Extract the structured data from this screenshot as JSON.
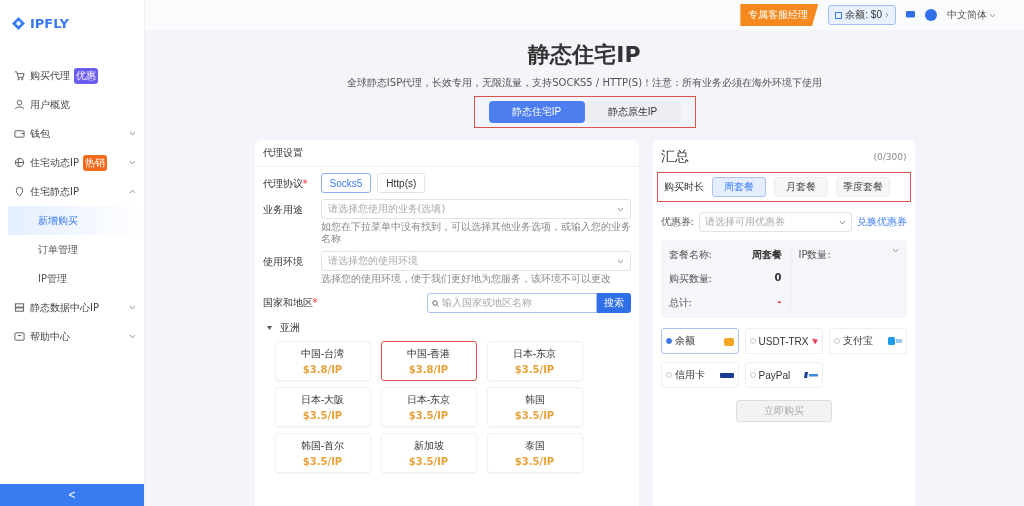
{
  "logo": {
    "text": "IPFLY"
  },
  "sidebar": {
    "items": [
      {
        "label": "购买代理",
        "badge": {
          "text": "优惠",
          "color": "#6b5cf0"
        }
      },
      {
        "label": "用户概览"
      },
      {
        "label": "钱包",
        "expanded": false
      },
      {
        "label": "住宅动态IP",
        "badge": {
          "text": "热销",
          "color": "#f26b1d"
        },
        "expanded": false
      },
      {
        "label": "住宅静态IP",
        "expanded": true,
        "children": [
          {
            "label": "新增购买",
            "selected": true
          },
          {
            "label": "订单管理",
            "selected": false
          },
          {
            "label": "IP管理",
            "selected": false
          }
        ]
      },
      {
        "label": "静态数据中心IP",
        "expanded": false
      },
      {
        "label": "帮助中心",
        "expanded": false
      }
    ],
    "collapse": "<"
  },
  "topbar": {
    "service_button": "专属客服经理",
    "balance": "余额: $0",
    "language": "中文简体"
  },
  "page": {
    "title": "静态住宅IP",
    "subtitle": "全球静态ISP代理，长效专用，无限流量，支持SOCKS5 / HTTP(S)！注意：所有业务必须在海外环境下使用",
    "tabs": [
      {
        "label": "静态住宅IP",
        "selected": true
      },
      {
        "label": "静态原生IP",
        "selected": false
      }
    ]
  },
  "proxy_settings": {
    "title": "代理设置",
    "protocol": {
      "label": "代理协议",
      "required_mark": "*",
      "options": [
        {
          "label": "Socks5",
          "selected": true
        },
        {
          "label": "Http(s)",
          "selected": false
        }
      ]
    },
    "purpose": {
      "label": "业务用途",
      "placeholder": "请选择您使用的业务(选填)",
      "hint": "如您在下拉菜单中没有找到，可以选择其他业务选项，或输入您的业务名称"
    },
    "environment": {
      "label": "使用环境",
      "placeholder": "请选择您的使用环境",
      "hint": "选择您的使用环境，便于我们更好地为您服务，该环境不可以更改"
    },
    "region": {
      "label": "国家和地区",
      "required_mark": "*",
      "search_placeholder": "输入国家或地区名称",
      "search_button": "搜索"
    },
    "group": {
      "name": "亚洲",
      "expanded": true,
      "locations": [
        {
          "name": "中国-台湾",
          "price": "$3.8/IP",
          "selected": false
        },
        {
          "name": "中国-香港",
          "price": "$3.8/IP",
          "selected": true
        },
        {
          "name": "日本-东京",
          "price": "$3.5/IP",
          "selected": false
        },
        {
          "name": "日本-大阪",
          "price": "$3.5/IP",
          "selected": false
        },
        {
          "name": "日本-东京",
          "price": "$3.5/IP",
          "selected": false
        },
        {
          "name": "韩国",
          "price": "$3.5/IP",
          "selected": false
        },
        {
          "name": "韩国-首尔",
          "price": "$3.5/IP",
          "selected": false
        },
        {
          "name": "新加坡",
          "price": "$3.5/IP",
          "selected": false
        },
        {
          "name": "泰国",
          "price": "$3.5/IP",
          "selected": false
        }
      ]
    }
  },
  "summary": {
    "title": "汇总",
    "count": "(0/300)",
    "duration": {
      "label": "购买时长",
      "options": [
        {
          "label": "周套餐",
          "selected": true
        },
        {
          "label": "月套餐",
          "selected": false
        },
        {
          "label": "季度套餐",
          "selected": false
        }
      ]
    },
    "coupon": {
      "label": "优惠券:",
      "placeholder": "请选择可用优惠券",
      "link": "兑换优惠券"
    },
    "details": [
      {
        "label": "套餐名称:",
        "value": "周套餐",
        "kind": "text"
      },
      {
        "label": "购买数量:",
        "value": "0",
        "kind": "text"
      },
      {
        "label": "总计:",
        "value": "-",
        "kind": "total"
      }
    ],
    "ip_label": "IP数量:",
    "payments": [
      {
        "label": "余额",
        "selected": true
      },
      {
        "label": "USDT-TRX",
        "selected": false
      },
      {
        "label": "支付宝",
        "selected": false
      },
      {
        "label": "信用卡",
        "selected": false
      },
      {
        "label": "PayPal",
        "selected": false
      }
    ],
    "buy_button": {
      "label": "立即购买",
      "disabled": true
    }
  }
}
